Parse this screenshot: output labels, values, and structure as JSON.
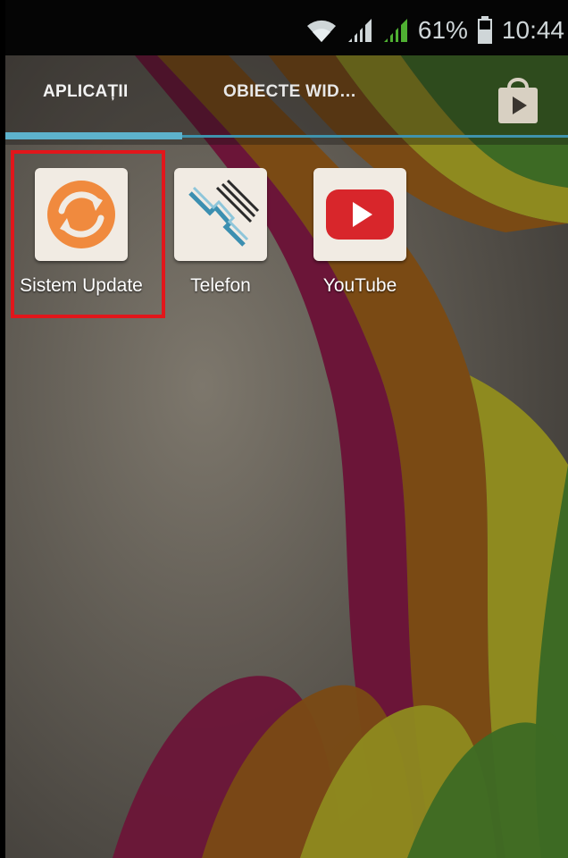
{
  "status_bar": {
    "battery_percent": "61%",
    "time": "10:44",
    "icons": [
      "wifi-icon",
      "signal-icon",
      "signal-icon",
      "battery-icon"
    ]
  },
  "tabs": {
    "apps_label": "APLICAȚII",
    "widgets_label": "OBIECTE WID…",
    "active": "apps"
  },
  "store_icon": "play-store-icon",
  "apps": [
    {
      "label": "Sistem Updatе",
      "icon": "sync-icon"
    },
    {
      "label": "Telefon",
      "icon": "phone-icon"
    },
    {
      "label": "YouTube",
      "icon": "youtube-icon"
    }
  ],
  "colors": {
    "tab_indicator": "#5db2cc",
    "highlight": "#e2161b"
  }
}
